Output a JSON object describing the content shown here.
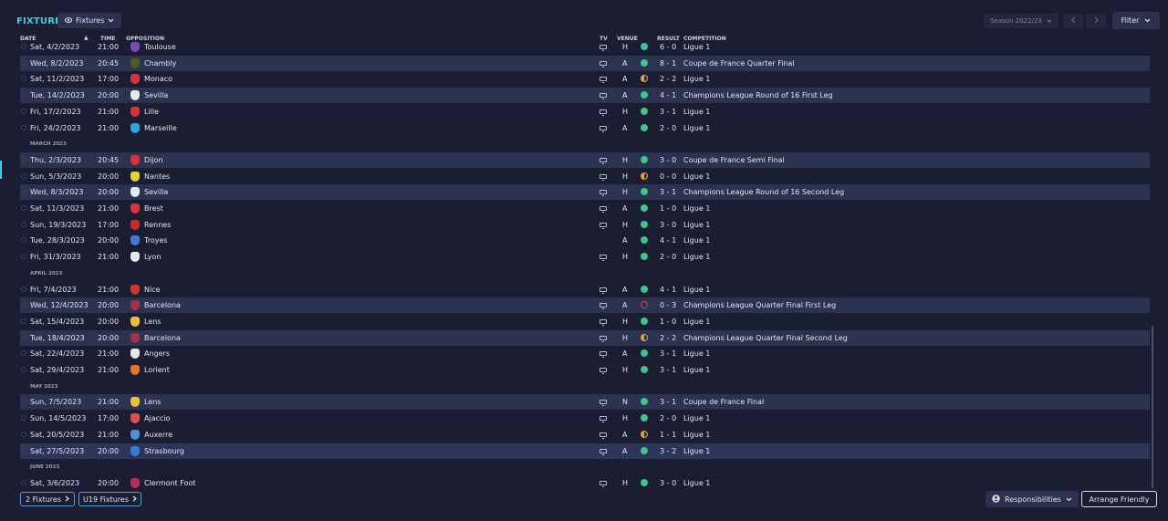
{
  "title": "FIXTURES",
  "view_button": {
    "label": "Fixtures",
    "icon": "eye-icon"
  },
  "season": "Season 2022/23",
  "filter_label": "Filter",
  "columns": {
    "date": "DATE",
    "time": "TIME",
    "opposition": "OPPOSITION",
    "tv": "TV",
    "venue": "VENUE",
    "result": "RESULT",
    "competition": "COMPETITION"
  },
  "result_colors": {
    "win": "#3cc68a",
    "draw": "#e7a325",
    "loss": "#d93d3d"
  },
  "rows": [
    {
      "kind": "match",
      "date": "Sat, 4/2/2023",
      "time": "21:00",
      "opp": "Toulouse",
      "tv": true,
      "venue": "H",
      "res": "W",
      "score": "6 - 0",
      "comp": "Ligue 1",
      "badge_color": "#7a4bb0",
      "style": ""
    },
    {
      "kind": "match",
      "date": "Wed, 8/2/2023",
      "time": "20:45",
      "opp": "Chambly",
      "tv": true,
      "venue": "A",
      "res": "W",
      "score": "8 - 1",
      "comp": "Coupe de France Quarter Final",
      "badge_color": "#4f5a2a",
      "style": "alt"
    },
    {
      "kind": "match",
      "date": "Sat, 11/2/2023",
      "time": "17:00",
      "opp": "Monaco",
      "tv": true,
      "venue": "A",
      "res": "D",
      "score": "2 - 2",
      "comp": "Ligue 1",
      "badge_color": "#d9323a",
      "style": ""
    },
    {
      "kind": "match",
      "date": "Tue, 14/2/2023",
      "time": "20:00",
      "opp": "Sevilla",
      "tv": true,
      "venue": "A",
      "res": "W",
      "score": "4 - 1",
      "comp": "Champions League Round of 16  First Leg",
      "badge_color": "#e7e7ea",
      "style": "alt"
    },
    {
      "kind": "match",
      "date": "Fri, 17/2/2023",
      "time": "21:00",
      "opp": "Lille",
      "tv": true,
      "venue": "H",
      "res": "W",
      "score": "3 - 1",
      "comp": "Ligue 1",
      "badge_color": "#d9323a",
      "style": ""
    },
    {
      "kind": "match",
      "date": "Fri, 24/2/2023",
      "time": "21:00",
      "opp": "Marseille",
      "tv": true,
      "venue": "A",
      "res": "W",
      "score": "2 - 0",
      "comp": "Ligue 1",
      "badge_color": "#2fa3db",
      "style": ""
    },
    {
      "kind": "month",
      "label": "MARCH 2023"
    },
    {
      "kind": "match",
      "date": "Thu, 2/3/2023",
      "time": "20:45",
      "opp": "Dijon",
      "tv": true,
      "venue": "H",
      "res": "W",
      "score": "3 - 0",
      "comp": "Coupe de France Semi Final",
      "badge_color": "#d9323a",
      "style": "alt"
    },
    {
      "kind": "match",
      "date": "Sun, 5/3/2023",
      "time": "20:00",
      "opp": "Nantes",
      "tv": true,
      "venue": "H",
      "res": "D",
      "score": "0 - 0",
      "comp": "Ligue 1",
      "badge_color": "#e8d33a",
      "style": ""
    },
    {
      "kind": "match",
      "date": "Wed, 8/3/2023",
      "time": "20:00",
      "opp": "Sevilla",
      "tv": true,
      "venue": "H",
      "res": "W",
      "score": "3 - 1",
      "comp": "Champions League Round of 16 Second Leg",
      "badge_color": "#e7e7ea",
      "style": "alt"
    },
    {
      "kind": "match",
      "date": "Sat, 11/3/2023",
      "time": "21:00",
      "opp": "Brest",
      "tv": true,
      "venue": "A",
      "res": "W",
      "score": "1 - 0",
      "comp": "Ligue 1",
      "badge_color": "#d9323a",
      "style": ""
    },
    {
      "kind": "match",
      "date": "Sun, 19/3/2023",
      "time": "17:00",
      "opp": "Rennes",
      "tv": true,
      "venue": "H",
      "res": "W",
      "score": "3 - 0",
      "comp": "Ligue 1",
      "badge_color": "#c92a2a",
      "style": ""
    },
    {
      "kind": "match",
      "date": "Tue, 28/3/2023",
      "time": "20:00",
      "opp": "Troyes",
      "tv": false,
      "venue": "A",
      "res": "W",
      "score": "4 - 1",
      "comp": "Ligue 1",
      "badge_color": "#3a7bd5",
      "style": ""
    },
    {
      "kind": "match",
      "date": "Fri, 31/3/2023",
      "time": "21:00",
      "opp": "Lyon",
      "tv": true,
      "venue": "H",
      "res": "W",
      "score": "2 - 0",
      "comp": "Ligue 1",
      "badge_color": "#e7e7ea",
      "style": ""
    },
    {
      "kind": "month",
      "label": "APRIL 2023"
    },
    {
      "kind": "match",
      "date": "Fri, 7/4/2023",
      "time": "21:00",
      "opp": "Nice",
      "tv": true,
      "venue": "A",
      "res": "W",
      "score": "4 - 1",
      "comp": "Ligue 1",
      "badge_color": "#c9382a",
      "style": ""
    },
    {
      "kind": "match",
      "date": "Wed, 12/4/2023",
      "time": "20:00",
      "opp": "Barcelona",
      "tv": true,
      "venue": "A",
      "res": "L",
      "score": "0 - 3",
      "comp": "Champions League Quarter Final First Leg",
      "badge_color": "#a6304a",
      "style": "alt"
    },
    {
      "kind": "match",
      "date": "Sat, 15/4/2023",
      "time": "20:00",
      "opp": "Lens",
      "tv": true,
      "venue": "H",
      "res": "W",
      "score": "1 - 0",
      "comp": "Ligue 1",
      "badge_color": "#e8c03a",
      "style": ""
    },
    {
      "kind": "match",
      "date": "Tue, 18/4/2023",
      "time": "20:00",
      "opp": "Barcelona",
      "tv": true,
      "venue": "H",
      "res": "D",
      "score": "2 - 2",
      "comp": "Champions League Quarter Final Second Leg",
      "badge_color": "#a6304a",
      "style": "alt"
    },
    {
      "kind": "match",
      "date": "Sat, 22/4/2023",
      "time": "21:00",
      "opp": "Angers",
      "tv": true,
      "venue": "A",
      "res": "W",
      "score": "3 - 1",
      "comp": "Ligue 1",
      "badge_color": "#e7e7ea",
      "style": ""
    },
    {
      "kind": "match",
      "date": "Sat, 29/4/2023",
      "time": "21:00",
      "opp": "Lorient",
      "tv": true,
      "venue": "H",
      "res": "W",
      "score": "3 - 1",
      "comp": "Ligue 1",
      "badge_color": "#e3762a",
      "style": ""
    },
    {
      "kind": "month",
      "label": "MAY 2023"
    },
    {
      "kind": "match",
      "date": "Sun, 7/5/2023",
      "time": "21:00",
      "opp": "Lens",
      "tv": true,
      "venue": "N",
      "res": "W",
      "score": "3 - 1",
      "comp": "Coupe de France Final",
      "badge_color": "#e8c03a",
      "style": "alt"
    },
    {
      "kind": "match",
      "date": "Sun, 14/5/2023",
      "time": "17:00",
      "opp": "Ajaccio",
      "tv": true,
      "venue": "H",
      "res": "W",
      "score": "2 - 0",
      "comp": "Ligue 1",
      "badge_color": "#e05050",
      "style": ""
    },
    {
      "kind": "match",
      "date": "Sat, 20/5/2023",
      "time": "21:00",
      "opp": "Auxerre",
      "tv": true,
      "venue": "A",
      "res": "D",
      "score": "1 - 1",
      "comp": "Ligue 1",
      "badge_color": "#4f8fd8",
      "style": ""
    },
    {
      "kind": "match",
      "date": "Sat, 27/5/2023",
      "time": "20:00",
      "opp": "Strasbourg",
      "tv": true,
      "venue": "A",
      "res": "W",
      "score": "3 - 2",
      "comp": "Ligue 1",
      "badge_color": "#3a7bd5",
      "style": "sel"
    },
    {
      "kind": "month",
      "label": "JUNE 2023"
    },
    {
      "kind": "match",
      "date": "Sat, 3/6/2023",
      "time": "20:00",
      "opp": "Clermont Foot",
      "tv": true,
      "venue": "H",
      "res": "W",
      "score": "3 - 0",
      "comp": "Ligue 1",
      "badge_color": "#b0305a",
      "style": ""
    }
  ],
  "footer": {
    "link1": "2 Fixtures",
    "link2": "U19 Fixtures",
    "responsibilities": "Responsibilities",
    "arrange": "Arrange Friendly"
  }
}
